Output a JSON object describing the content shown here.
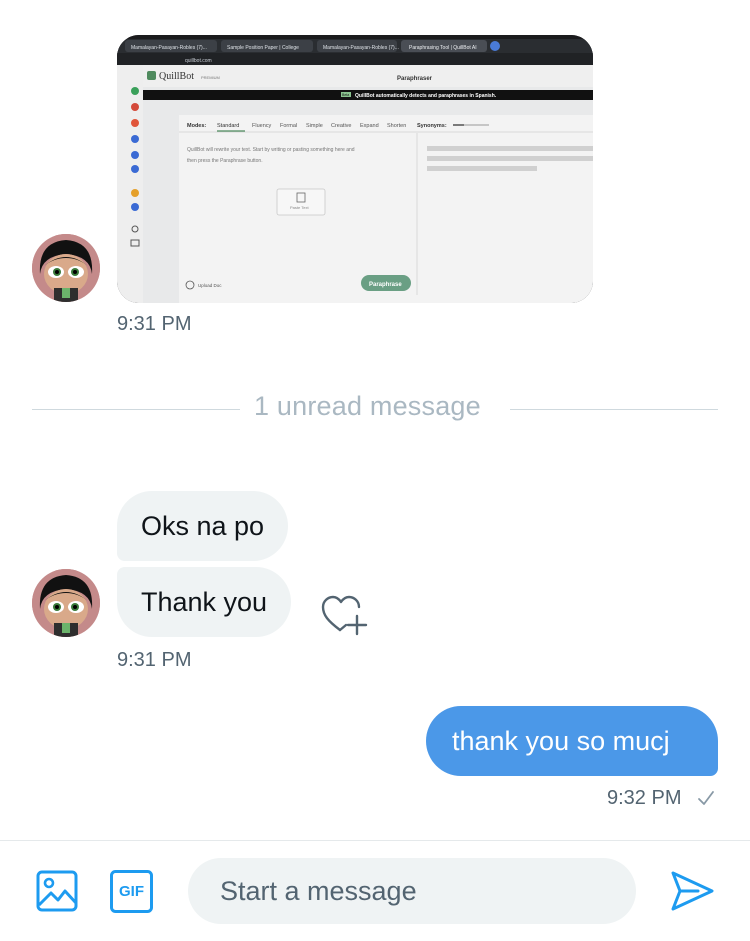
{
  "conversation": {
    "photo_message": {
      "timestamp": "9:31 PM",
      "screenshot": {
        "browser_tabs": [
          "Mamalayan-Pasayan-Robles (7)...",
          "Sample Position Paper | College",
          "Mamalayan-Pasayan-Robles (7)...",
          "Paraphrasing Tool | QuillBot AI"
        ],
        "url": "quillbot.com",
        "app_name": "QuillBot",
        "plan_label": "PREMIUM",
        "page_title": "Paraphraser",
        "banner_badge": "Beta",
        "banner_text": "QuillBot automatically detects and paraphrases in Spanish.",
        "modes_label": "Modes:",
        "modes": [
          "Standard",
          "Fluency",
          "Formal",
          "Simple",
          "Creative",
          "Expand",
          "Shorten"
        ],
        "synonyms_label": "Synonyms:",
        "input_hint_line1": "QuillBot will rewrite your text. Start by writing or pasting something here and",
        "input_hint_line2": "then press the Paraphrase button.",
        "paste_label": "Paste Text",
        "upload_label": "Upload Doc",
        "paraphrase_button": "Paraphrase"
      }
    },
    "unread_divider": "1 unread message",
    "incoming_group": {
      "messages": [
        "Oks na po",
        "Thank you"
      ],
      "timestamp": "9:31 PM"
    },
    "outgoing": {
      "text": "thank you so mucj",
      "timestamp": "9:32 PM",
      "status_icon": "check-icon"
    }
  },
  "composer": {
    "placeholder": "Start a message",
    "gif_label": "GIF",
    "image_icon": "image-icon",
    "send_icon": "send-icon"
  },
  "colors": {
    "accent": "#1d9bf0",
    "outgoing_bubble": "#4b98e8",
    "incoming_bubble": "#eff3f4",
    "secondary_text": "#536471"
  }
}
